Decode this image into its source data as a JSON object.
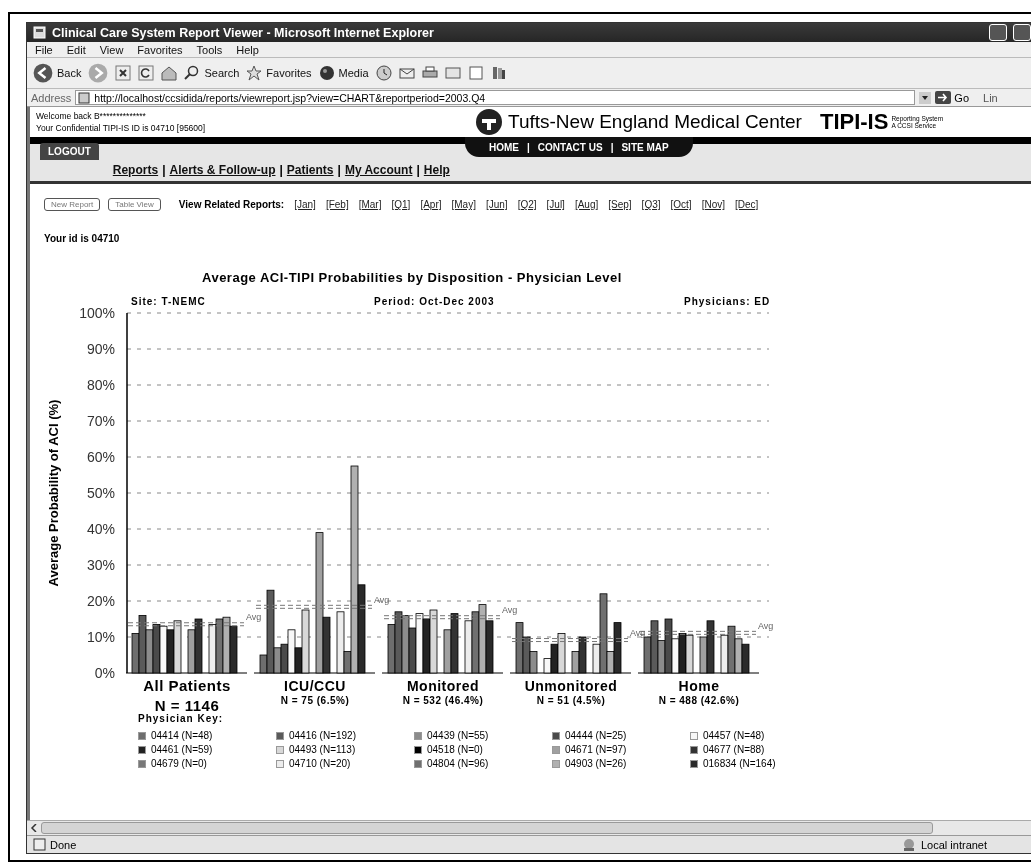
{
  "window": {
    "title": "Clinical Care System Report Viewer - Microsoft Internet Explorer"
  },
  "menu": [
    "File",
    "Edit",
    "View",
    "Favorites",
    "Tools",
    "Help"
  ],
  "toolbar": [
    {
      "kind": "back",
      "label": "Back"
    },
    {
      "kind": "forward"
    },
    {
      "kind": "stop"
    },
    {
      "kind": "refresh"
    },
    {
      "kind": "home"
    },
    {
      "kind": "search",
      "label": "Search"
    },
    {
      "kind": "favorites",
      "label": "Favorites"
    },
    {
      "kind": "media",
      "label": "Media"
    },
    {
      "kind": "history"
    },
    {
      "kind": "mail"
    },
    {
      "kind": "print"
    },
    {
      "kind": "edit"
    },
    {
      "kind": "discuss"
    },
    {
      "kind": "research"
    }
  ],
  "address_bar": {
    "label": "Address",
    "url": "http://localhost/ccsidida/reports/viewreport.jsp?view=CHART&reportperiod=2003.Q4",
    "go": "Go",
    "links": "Lin"
  },
  "header": {
    "welcome": "Welcome back B**************",
    "id_line": "Your Confidential TIPI-IS ID is 04710 [95600]",
    "org": "Tufts-New England Medical Center",
    "brand": "TIPI-IS",
    "brand_sub": [
      "Reporting System",
      "A CCSI Service"
    ]
  },
  "nav": {
    "logout": "LOGOUT",
    "separator": "|",
    "links": [
      "Reports",
      "Alerts & Follow-up",
      "Patients",
      "My Account",
      "Help"
    ],
    "top_links": [
      "HOME",
      "CONTACT US",
      "SITE MAP"
    ]
  },
  "actions": [
    "New Report",
    "Table View"
  ],
  "related": {
    "label": "View Related Reports:",
    "links": [
      "[Jan]",
      "[Feb]",
      "[Mar]",
      "[Q1]",
      "[Apr]",
      "[May]",
      "[Jun]",
      "[Q2]",
      "[Jul]",
      "[Aug]",
      "[Sep]",
      "[Q3]",
      "[Oct]",
      "[Nov]",
      "[Dec]"
    ]
  },
  "id_text": "Your id is 04710",
  "chart_header": [
    "Site: T-NEMC",
    "Period: Oct-Dec 2003",
    "Physicians: ED"
  ],
  "group_counts": [
    "N = 1146",
    "N = 75 (6.5%)",
    "N = 532 (46.4%)",
    "N = 51 (4.5%)",
    "N = 488 (42.6%)"
  ],
  "chart_data": {
    "type": "bar",
    "title": "Average ACI-TIPI Probabilities by Disposition - Physician Level",
    "ylabel": "Average Probability of ACI (%)",
    "categories": [
      "All Patients",
      "ICU/CCU",
      "Monitored",
      "Unmonitored",
      "Home"
    ],
    "ylim": [
      0,
      100
    ],
    "yticks": [
      {
        "value": 0,
        "label": "0%"
      },
      {
        "value": 10,
        "label": "10%"
      },
      {
        "value": 20,
        "label": "20%"
      },
      {
        "value": 30,
        "label": "30%"
      },
      {
        "value": 40,
        "label": "40%"
      },
      {
        "value": 50,
        "label": "50%"
      },
      {
        "value": 60,
        "label": "60%"
      },
      {
        "value": 70,
        "label": "70%"
      },
      {
        "value": 80,
        "label": "80%"
      },
      {
        "value": 90,
        "label": "90%"
      },
      {
        "value": 100,
        "label": "100%"
      }
    ],
    "grid": true,
    "annotations": [
      "Avg",
      "Avg",
      "Avg",
      "Avg",
      "Avg"
    ],
    "series": [
      {
        "name": "04414 (N=48)",
        "color": "#6e6e6e",
        "values": [
          11,
          5,
          13.5,
          14,
          10
        ]
      },
      {
        "name": "04416 (N=192)",
        "color": "#5a5a5a",
        "values": [
          16,
          23,
          17,
          10,
          14.5
        ]
      },
      {
        "name": "04439 (N=55)",
        "color": "#8c8c8c",
        "values": [
          12,
          7,
          16,
          6,
          9
        ]
      },
      {
        "name": "04444 (N=25)",
        "color": "#4a4a4a",
        "values": [
          13.5,
          8,
          12.5,
          0,
          15
        ]
      },
      {
        "name": "04457 (N=48)",
        "color": "#f8f8f8",
        "values": [
          13,
          12,
          16.5,
          4,
          9.5
        ]
      },
      {
        "name": "04461 (N=59)",
        "color": "#222222",
        "values": [
          12,
          7,
          15,
          8,
          11
        ]
      },
      {
        "name": "04493 (N=113)",
        "color": "#d8d8d8",
        "values": [
          14.5,
          17.5,
          17.5,
          11,
          10.5
        ]
      },
      {
        "name": "04518 (N=0)",
        "color": "#000000",
        "values": [
          null,
          null,
          null,
          null,
          null
        ]
      },
      {
        "name": "04671 (N=97)",
        "color": "#a0a0a0",
        "values": [
          12,
          39,
          12,
          6,
          10
        ]
      },
      {
        "name": "04677 (N=88)",
        "color": "#333333",
        "values": [
          15,
          15.5,
          16.5,
          10,
          14.5
        ]
      },
      {
        "name": "04679 (N=0)",
        "color": "#787878",
        "values": [
          null,
          null,
          null,
          null,
          null
        ]
      },
      {
        "name": "04710 (N=20)",
        "color": "#ededed",
        "values": [
          13.5,
          17,
          14.5,
          8,
          10.5
        ]
      },
      {
        "name": "04804 (N=96)",
        "color": "#707070",
        "values": [
          15,
          6,
          17,
          22,
          13
        ]
      },
      {
        "name": "04903 (N=26)",
        "color": "#b0b0b0",
        "values": [
          15.5,
          57.5,
          19,
          6,
          9.5
        ]
      },
      {
        "name": "016834 (N=164)",
        "color": "#2a2a2a",
        "values": [
          13,
          24.5,
          14.5,
          14,
          8
        ]
      }
    ]
  },
  "legend_title": "Physician Key:",
  "status_bar": {
    "text": "Done",
    "zone": "Local intranet"
  }
}
